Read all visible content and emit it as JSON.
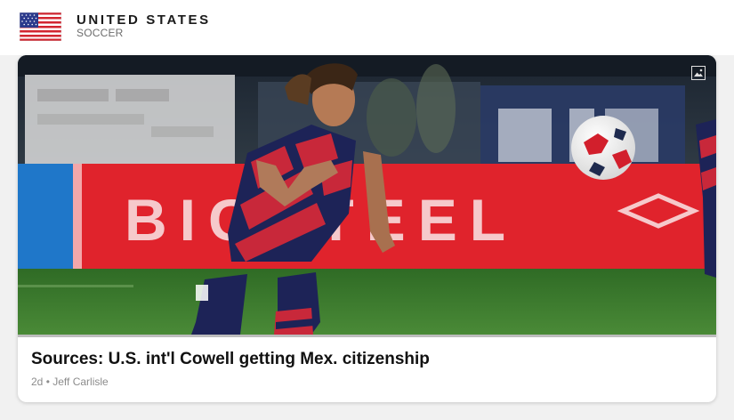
{
  "team": {
    "name": "UNITED STATES",
    "sport": "SOCCER",
    "flag_icon": "us-flag"
  },
  "story": {
    "headline": "Sources: U.S. int'l Cowell getting Mex. citizenship",
    "age": "2d",
    "separator": "•",
    "author": "Jeff Carlisle",
    "photo_icon": "image-icon",
    "board_text": "BIGSTEEL"
  },
  "colors": {
    "board_red": "#e0232c",
    "pitch_green": "#3f7c2e",
    "kit_navy": "#1d2357",
    "kit_red": "#c8283a"
  }
}
